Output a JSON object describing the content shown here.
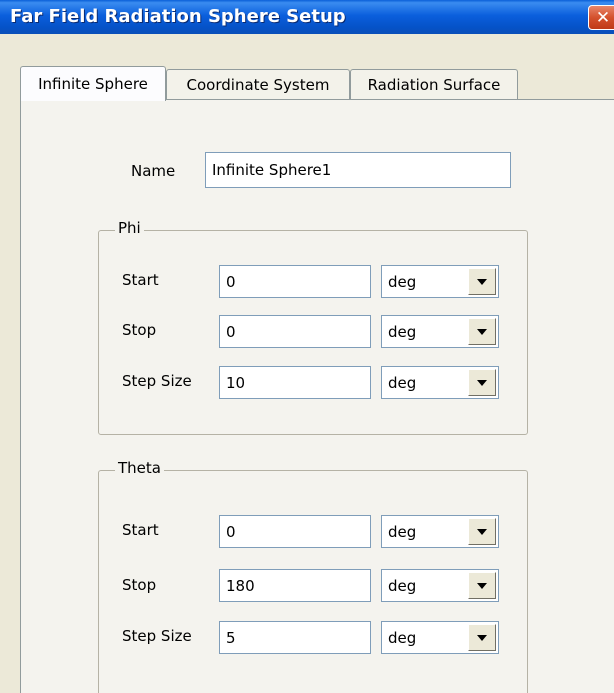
{
  "window": {
    "title": "Far Field Radiation Sphere Setup",
    "close_symbol": "✕"
  },
  "tabs": [
    {
      "label": "Infinite Sphere",
      "active": true
    },
    {
      "label": "Coordinate System",
      "active": false
    },
    {
      "label": "Radiation Surface",
      "active": false
    }
  ],
  "name": {
    "label": "Name",
    "value": "Infinite Sphere1"
  },
  "phi": {
    "legend": "Phi",
    "rows": [
      {
        "label": "Start",
        "value": "0",
        "unit": "deg"
      },
      {
        "label": "Stop",
        "value": "0",
        "unit": "deg"
      },
      {
        "label": "Step Size",
        "value": "10",
        "unit": "deg"
      }
    ]
  },
  "theta": {
    "legend": "Theta",
    "rows": [
      {
        "label": "Start",
        "value": "0",
        "unit": "deg"
      },
      {
        "label": "Stop",
        "value": "180",
        "unit": "deg"
      },
      {
        "label": "Step Size",
        "value": "5",
        "unit": "deg"
      }
    ]
  },
  "colors": {
    "titlebar": "#0b5fdd",
    "dialog_bg": "#ece9d8",
    "close_button": "#d4512d"
  },
  "icons": {
    "close": "close-icon",
    "dropdown": "chevron-down-icon"
  }
}
